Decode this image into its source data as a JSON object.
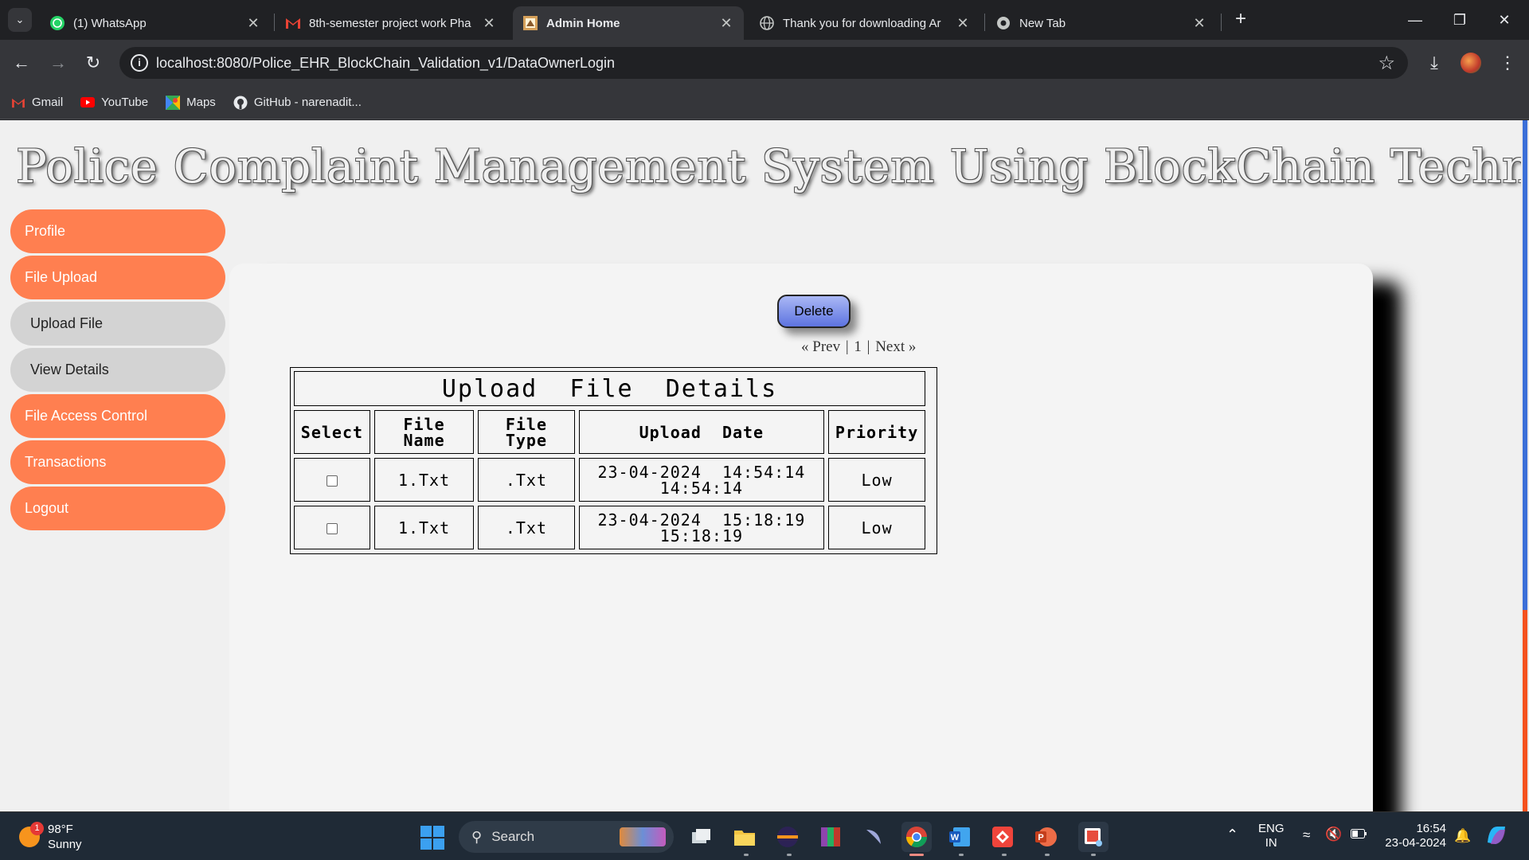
{
  "browser": {
    "tabs": [
      {
        "title": "(1) WhatsApp",
        "icon": "whatsapp-icon",
        "active": false
      },
      {
        "title": "8th-semester project work Pha",
        "icon": "gmail-icon",
        "active": false
      },
      {
        "title": "Admin Home",
        "icon": "site-icon",
        "active": true
      },
      {
        "title": "Thank you for downloading Ar",
        "icon": "globe-icon",
        "active": false
      },
      {
        "title": "New Tab",
        "icon": "chrome-icon",
        "active": false
      }
    ],
    "url": "localhost:8080/Police_EHR_BlockChain_Validation_v1/DataOwnerLogin",
    "bookmarks": [
      {
        "label": "Gmail",
        "icon": "gmail-icon"
      },
      {
        "label": "YouTube",
        "icon": "youtube-icon"
      },
      {
        "label": "Maps",
        "icon": "maps-icon"
      },
      {
        "label": "GitHub - narenadit...",
        "icon": "github-icon"
      }
    ]
  },
  "page": {
    "title": "Police Complaint Management System Using BlockChain Technology",
    "sidebar": [
      {
        "label": "Profile",
        "type": "main"
      },
      {
        "label": "File Upload",
        "type": "main"
      },
      {
        "label": "Upload File",
        "type": "sub"
      },
      {
        "label": "View Details",
        "type": "sub"
      },
      {
        "label": "File Access Control",
        "type": "main"
      },
      {
        "label": "Transactions",
        "type": "main"
      },
      {
        "label": "Logout",
        "type": "main"
      }
    ],
    "delete_label": "Delete",
    "pager": {
      "prev": "« Prev",
      "sep1": "|",
      "page": "1",
      "sep2": "|",
      "next": "Next »"
    },
    "table": {
      "caption": "Upload  File  Details",
      "headers": [
        "Select",
        "File\nName",
        "File\nType",
        "Upload  Date",
        "Priority"
      ],
      "rows": [
        {
          "file_name": "1.Txt",
          "file_type": ".Txt",
          "date_line1": "23-04-2024  14:54:14",
          "date_line2": "14:54:14",
          "priority": "Low"
        },
        {
          "file_name": "1.Txt",
          "file_type": ".Txt",
          "date_line1": "23-04-2024  15:18:19",
          "date_line2": "15:18:19",
          "priority": "Low"
        }
      ]
    }
  },
  "taskbar": {
    "weather": {
      "temp": "98°F",
      "condition": "Sunny",
      "badge": "1"
    },
    "search_label": "Search",
    "lang": {
      "line1": "ENG",
      "line2": "IN"
    },
    "clock": {
      "time": "16:54",
      "date": "23-04-2024"
    }
  },
  "colors": {
    "sidebar_main": "#ff7f50",
    "sidebar_sub": "#d3d3d3",
    "delete_button": "#7085e8",
    "browser_dark": "#202124"
  }
}
